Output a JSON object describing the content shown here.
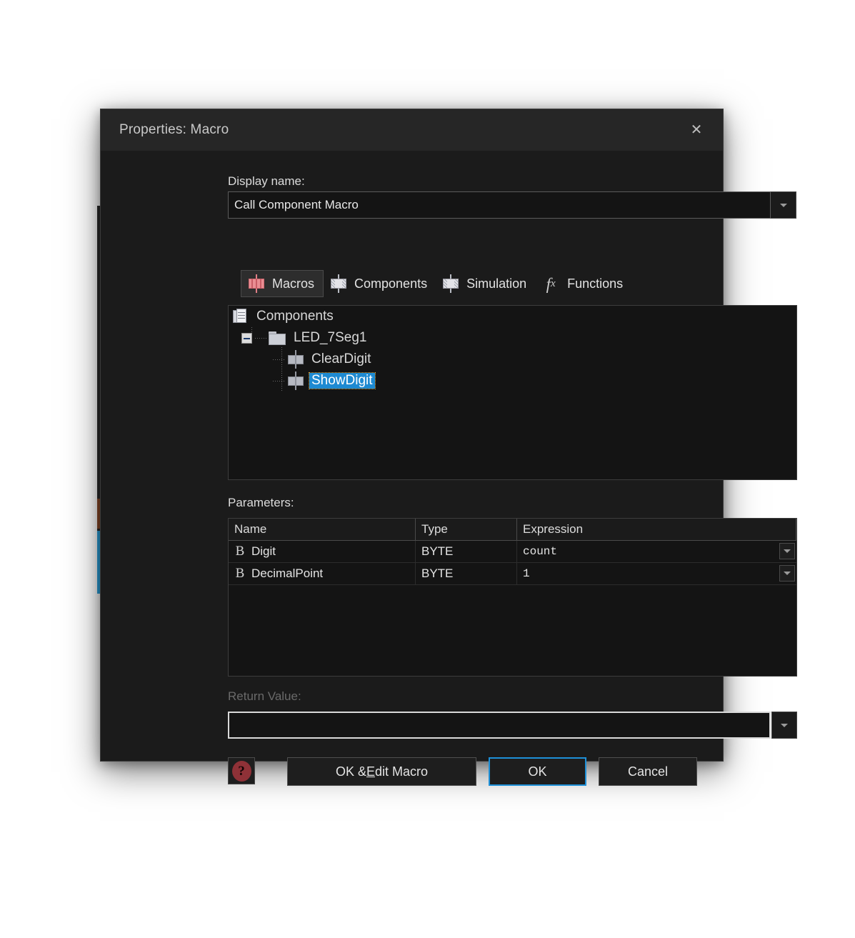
{
  "dialog": {
    "title": "Properties: Macro",
    "close_icon": "close-icon"
  },
  "display_name": {
    "label": "Display name:",
    "value": "Call Component Macro",
    "dropdown_icon": "chevron-down-icon"
  },
  "tabs": [
    {
      "label": "Macros",
      "icon": "macro-block-icon",
      "active": true
    },
    {
      "label": "Components",
      "icon": "component-block-icon",
      "active": false
    },
    {
      "label": "Simulation",
      "icon": "simulation-block-icon",
      "active": false
    },
    {
      "label": "Functions",
      "icon": "fx-icon",
      "active": false
    }
  ],
  "tree": {
    "root": {
      "label": "Components",
      "icon": "documents-icon"
    },
    "group": {
      "label": "LED_7Seg1",
      "icon": "folder-icon",
      "expander": "minus-expander-icon"
    },
    "items": [
      {
        "label": "ClearDigit",
        "icon": "macro-leaf-icon",
        "selected": false
      },
      {
        "label": "ShowDigit",
        "icon": "macro-leaf-icon",
        "selected": true
      }
    ]
  },
  "parameters": {
    "label": "Parameters:",
    "columns": [
      "Name",
      "Type",
      "Expression"
    ],
    "rows": [
      {
        "icon": "byte-type-icon",
        "name": "Digit",
        "type": "BYTE",
        "expression": "count",
        "dropdown_icon": "chevron-down-icon"
      },
      {
        "icon": "byte-type-icon",
        "name": "DecimalPoint",
        "type": "BYTE",
        "expression": "1",
        "dropdown_icon": "chevron-down-icon"
      }
    ]
  },
  "return_value": {
    "label": "Return Value:",
    "value": "",
    "disabled": true,
    "dropdown_icon": "chevron-down-icon"
  },
  "footer": {
    "help_icon": "help-question-icon",
    "edit_macro_pre": "OK & ",
    "edit_macro_accel": "E",
    "edit_macro_post": "dit Macro",
    "ok_label": "OK",
    "cancel_label": "Cancel"
  },
  "colors": {
    "accent_blue": "#1e8ad1",
    "focus_blue": "#1e90d8",
    "macro_red": "#e98e93",
    "help_red": "#8f3137",
    "dialog_bg": "#1b1b1b",
    "titlebar_bg": "#262626",
    "field_bg": "#141414"
  }
}
